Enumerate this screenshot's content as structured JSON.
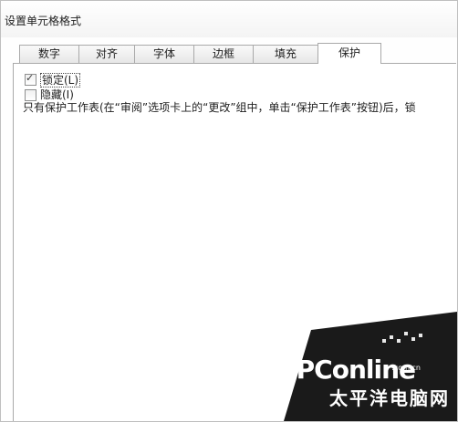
{
  "window": {
    "title": "设置单元格格式"
  },
  "tabs": [
    {
      "label": "数字",
      "active": false
    },
    {
      "label": "对齐",
      "active": false
    },
    {
      "label": "字体",
      "active": false
    },
    {
      "label": "边框",
      "active": false
    },
    {
      "label": "填充",
      "active": false
    },
    {
      "label": "保护",
      "active": true
    }
  ],
  "protection": {
    "locked": {
      "label": "锁定(L)",
      "checked": true
    },
    "hidden": {
      "label": "隐藏(I)",
      "checked": false
    },
    "description": "只有保护工作表(在“审阅”选项卡上的“更改”组中，单击“保护工作表”按钮)后，锁"
  },
  "watermark": {
    "logo": "PConline",
    "domain": ".com.cn",
    "chinese": "太平洋电脑网"
  },
  "colors": {
    "tab_border": "#a9a9a9",
    "watermark_bg": "#1a1a1a"
  }
}
